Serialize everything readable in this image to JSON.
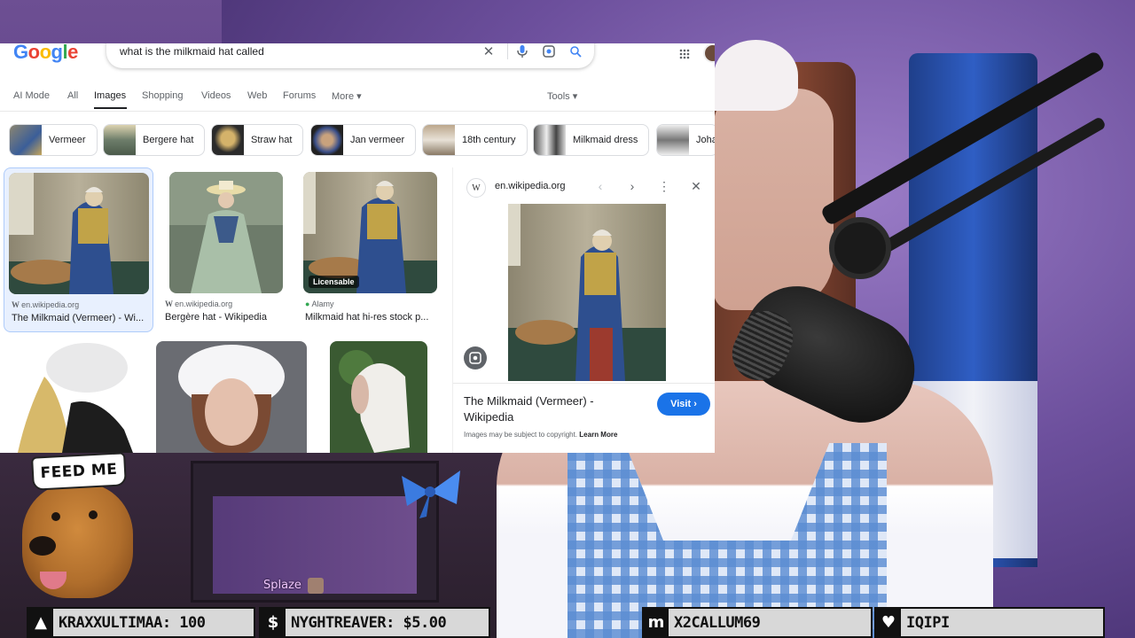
{
  "search": {
    "logo": "Google",
    "query": "what is the milkmaid hat called"
  },
  "tabs": [
    {
      "label": "AI Mode"
    },
    {
      "label": "All"
    },
    {
      "label": "Images",
      "active": true
    },
    {
      "label": "Shopping"
    },
    {
      "label": "Videos"
    },
    {
      "label": "Web"
    },
    {
      "label": "Forums"
    },
    {
      "label": "More ▾"
    }
  ],
  "tools_label": "Tools ▾",
  "chips": [
    {
      "label": "Vermeer"
    },
    {
      "label": "Bergere hat"
    },
    {
      "label": "Straw hat"
    },
    {
      "label": "Jan vermeer"
    },
    {
      "label": "18th century"
    },
    {
      "label": "Milkmaid dress"
    },
    {
      "label": "Joha"
    }
  ],
  "results": [
    {
      "source": "en.wikipedia.org",
      "title": "The Milkmaid (Vermeer) - Wi..."
    },
    {
      "source": "en.wikipedia.org",
      "title": "Bergère hat - Wikipedia"
    },
    {
      "source": "Alamy",
      "title": "Milkmaid hat hi-res stock p...",
      "badge": "Licensable"
    }
  ],
  "preview": {
    "favicon": "W",
    "domain": "en.wikipedia.org",
    "title": "The Milkmaid (Vermeer) - Wikipedia",
    "visit": "Visit ›",
    "copyright": "Images may be subject to copyright.",
    "learn_more": "Learn More"
  },
  "overlay": {
    "dog_hat_text": "FEED ME",
    "chat_username": "Splaze"
  },
  "alerts": [
    {
      "icon": "▲",
      "text": "KRAXXULTIMAA: 100"
    },
    {
      "icon": "$",
      "text": "NYGHTREAVER: $5.00"
    },
    {
      "icon": "m",
      "text": "X2CALLUM69"
    },
    {
      "icon": "♥",
      "text": "IQIPI"
    }
  ],
  "colors": {
    "google_blue": "#1a73e8",
    "alert_bg": "#d8d8d8"
  }
}
